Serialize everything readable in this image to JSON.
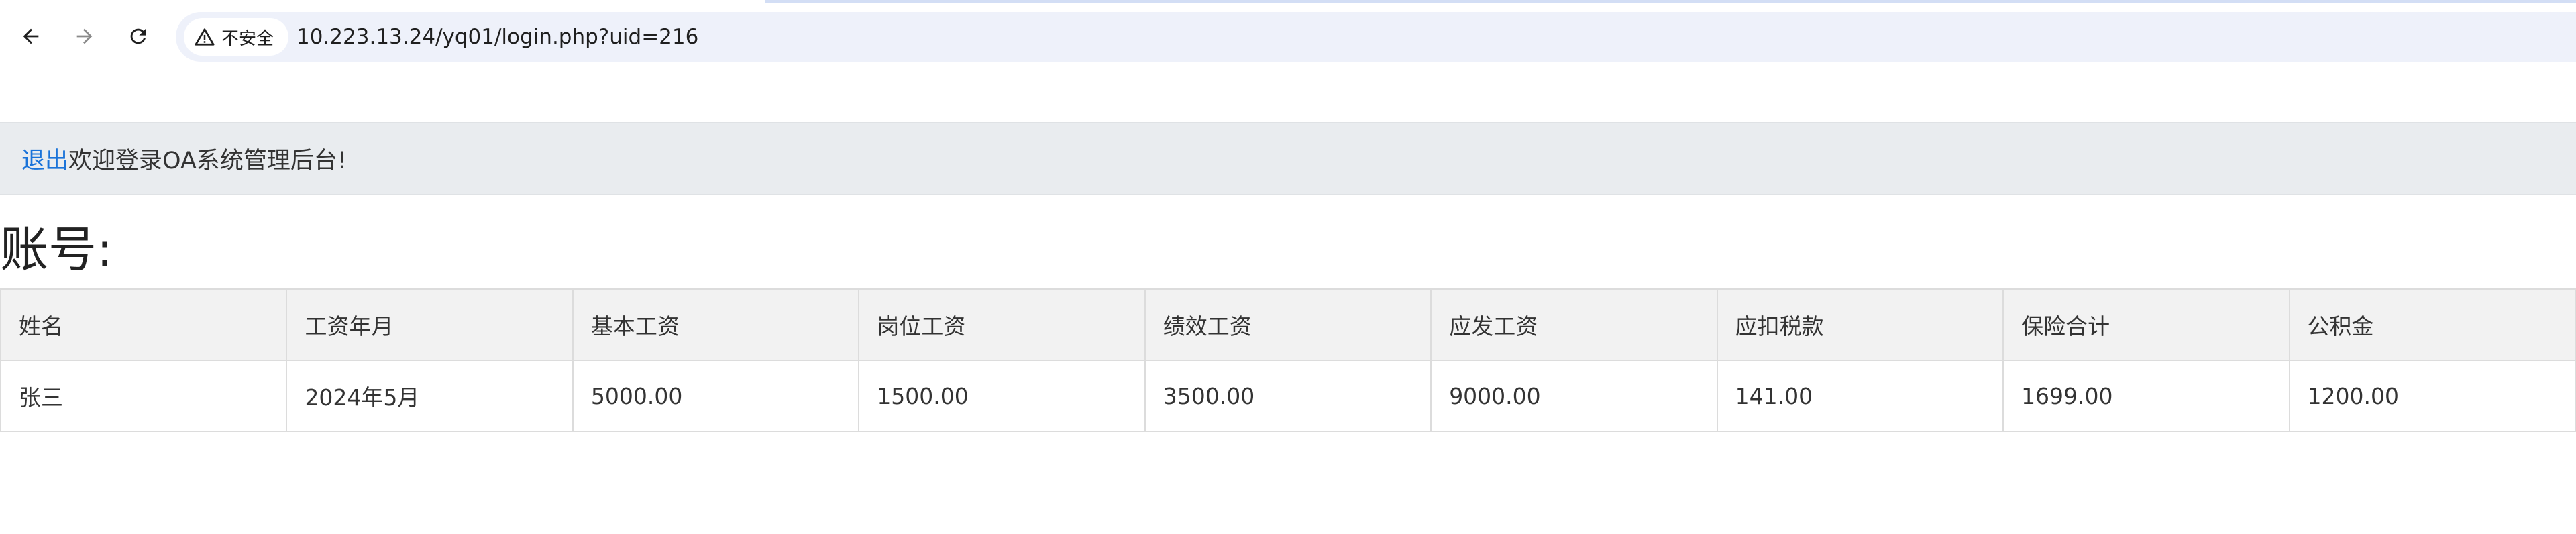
{
  "browser": {
    "security_label": "不安全",
    "url": "10.223.13.24/yq01/login.php?uid=216",
    "icons": [
      "back-arrow-icon",
      "forward-arrow-icon",
      "reload-icon",
      "warning-triangle-icon"
    ]
  },
  "welcome": {
    "logout_label": "退出",
    "message": "欢迎登录OA系统管理后台!"
  },
  "account_heading": "账号:",
  "table": {
    "headers": [
      "姓名",
      "工资年月",
      "基本工资",
      "岗位工资",
      "绩效工资",
      "应发工资",
      "应扣税款",
      "保险合计",
      "公积金"
    ],
    "rows": [
      [
        "张三",
        "2024年5月",
        "5000.00",
        "1500.00",
        "3500.00",
        "9000.00",
        "141.00",
        "1699.00",
        "1200.00"
      ]
    ]
  },
  "colors": {
    "link": "#1a73d9",
    "welcome_bar_bg": "#e9ecef",
    "table_header_bg": "#f2f2f2",
    "omnibox_bg": "#eef1fa"
  }
}
